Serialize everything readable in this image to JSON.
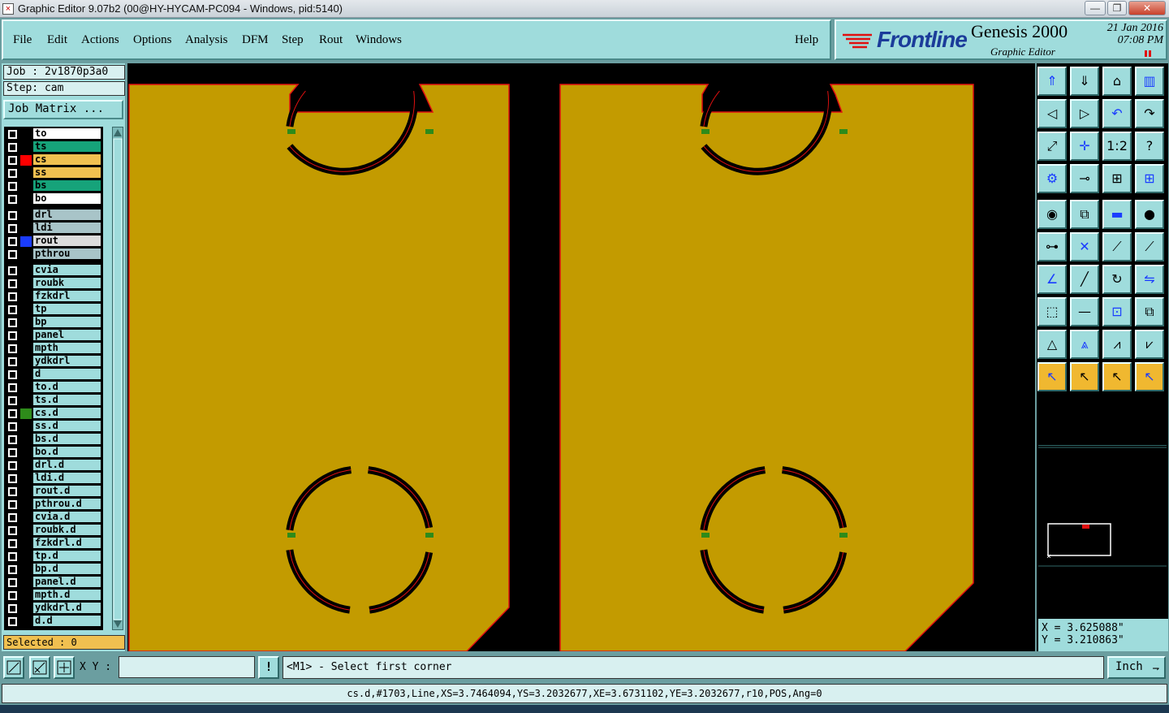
{
  "window": {
    "title": "Graphic Editor 9.07b2 (00@HY-HYCAM-PC094 - Windows, pid:5140)",
    "minimize": "—",
    "maximize": "❐",
    "close": "✕"
  },
  "menu": {
    "file": "File",
    "edit": "Edit",
    "actions": "Actions",
    "options": "Options",
    "analysis": "Analysis",
    "dfm": "DFM",
    "step": "Step",
    "rout": "Rout",
    "windows": "Windows",
    "help": "Help"
  },
  "branding": {
    "logo": "Frontline",
    "product": "Genesis 2000",
    "subtitle": "Graphic Editor",
    "date": "21 Jan 2016",
    "time": "07:08 PM"
  },
  "job": {
    "job_label": "Job : 2v1870p3a0",
    "step_label": "Step: cam",
    "matrix_button": "Job Matrix ..."
  },
  "layers": [
    {
      "name": "to",
      "bg": "#ffffff",
      "mark": ""
    },
    {
      "name": "ts",
      "bg": "#16a37a",
      "mark": ""
    },
    {
      "name": "cs",
      "bg": "#f0c050",
      "mark": "#ff0000"
    },
    {
      "name": "ss",
      "bg": "#f0c050",
      "mark": ""
    },
    {
      "name": "bs",
      "bg": "#16a37a",
      "mark": ""
    },
    {
      "name": "bo",
      "bg": "#ffffff",
      "mark": ""
    },
    {
      "name": "drl",
      "bg": "#a8c4c8",
      "mark": ""
    },
    {
      "name": "ldi",
      "bg": "#a8c4c8",
      "mark": ""
    },
    {
      "name": "rout",
      "bg": "#dcdcdc",
      "mark": "#1a3cff"
    },
    {
      "name": "pthrou",
      "bg": "#a8c4c8",
      "mark": ""
    },
    {
      "name": "cvia",
      "bg": "#9fdcdc",
      "mark": ""
    },
    {
      "name": "roubk",
      "bg": "#9fdcdc",
      "mark": ""
    },
    {
      "name": "fzkdrl",
      "bg": "#9fdcdc",
      "mark": ""
    },
    {
      "name": "tp",
      "bg": "#9fdcdc",
      "mark": ""
    },
    {
      "name": "bp",
      "bg": "#9fdcdc",
      "mark": ""
    },
    {
      "name": "panel",
      "bg": "#9fdcdc",
      "mark": ""
    },
    {
      "name": "mpth",
      "bg": "#9fdcdc",
      "mark": ""
    },
    {
      "name": "ydkdrl",
      "bg": "#9fdcdc",
      "mark": ""
    },
    {
      "name": "d",
      "bg": "#9fdcdc",
      "mark": ""
    },
    {
      "name": "to.d",
      "bg": "#9fdcdc",
      "mark": ""
    },
    {
      "name": "ts.d",
      "bg": "#9fdcdc",
      "mark": ""
    },
    {
      "name": "cs.d",
      "bg": "#9fdcdc",
      "mark": "#2e8b1a"
    },
    {
      "name": "ss.d",
      "bg": "#9fdcdc",
      "mark": ""
    },
    {
      "name": "bs.d",
      "bg": "#9fdcdc",
      "mark": ""
    },
    {
      "name": "bo.d",
      "bg": "#9fdcdc",
      "mark": ""
    },
    {
      "name": "drl.d",
      "bg": "#9fdcdc",
      "mark": ""
    },
    {
      "name": "ldi.d",
      "bg": "#9fdcdc",
      "mark": ""
    },
    {
      "name": "rout.d",
      "bg": "#9fdcdc",
      "mark": ""
    },
    {
      "name": "pthrou.d",
      "bg": "#9fdcdc",
      "mark": ""
    },
    {
      "name": "cvia.d",
      "bg": "#9fdcdc",
      "mark": ""
    },
    {
      "name": "roubk.d",
      "bg": "#9fdcdc",
      "mark": ""
    },
    {
      "name": "fzkdrl.d",
      "bg": "#9fdcdc",
      "mark": ""
    },
    {
      "name": "tp.d",
      "bg": "#9fdcdc",
      "mark": ""
    },
    {
      "name": "bp.d",
      "bg": "#9fdcdc",
      "mark": ""
    },
    {
      "name": "panel.d",
      "bg": "#9fdcdc",
      "mark": ""
    },
    {
      "name": "mpth.d",
      "bg": "#9fdcdc",
      "mark": ""
    },
    {
      "name": "ydkdrl.d",
      "bg": "#9fdcdc",
      "mark": ""
    },
    {
      "name": "d.d",
      "bg": "#9fdcdc",
      "mark": ""
    }
  ],
  "selected": "Selected : 0",
  "coords": {
    "x": "X = 3.625088\"",
    "y": "Y = 3.210863\""
  },
  "input": {
    "xy_label": "X Y :",
    "xy_value": "",
    "prompt": "<M1> - Select first corner",
    "units": "Inch"
  },
  "status": "cs.d,#1703,Line,XS=3.7464094,YS=3.2032677,XE=3.6731102,YE=3.2032677,r10,POS,Ang=0",
  "colors": {
    "copper": "#c39b00",
    "outline": "#e01010",
    "pad_green": "#2e8b1a",
    "panel_bg": "#9fdcdc"
  },
  "toolbar_icons": [
    "zoom-home-icon",
    "zoom-fit-icon",
    "home-view-icon",
    "split-view-icon",
    "pan-left-icon",
    "pan-right-icon",
    "undo-icon",
    "redo-icon",
    "fit-screen-icon",
    "center-icon",
    "scale-icon",
    "help-query-icon",
    "filter-icon",
    "connect-icon",
    "layer-compare-icon",
    "layer-compare-icon",
    "snap-pad-icon",
    "snap-corner-icon",
    "ruler-icon",
    "dot-icon",
    "node-icon",
    "cross-icon",
    "line-diagonal-icon",
    "line-diagonal-icon",
    "angle-icon",
    "line-edit-icon",
    "arc-icon",
    "mirror-icon",
    "select-box-icon",
    "minus-icon",
    "measure-icon",
    "copy-icon",
    "triangle-icon",
    "triangle-arrow-icon",
    "triangle-top-icon",
    "triangle-base-icon",
    "pointer-icon",
    "pointer-box-icon",
    "pointer-circle-icon",
    "pointer-multi-icon"
  ]
}
